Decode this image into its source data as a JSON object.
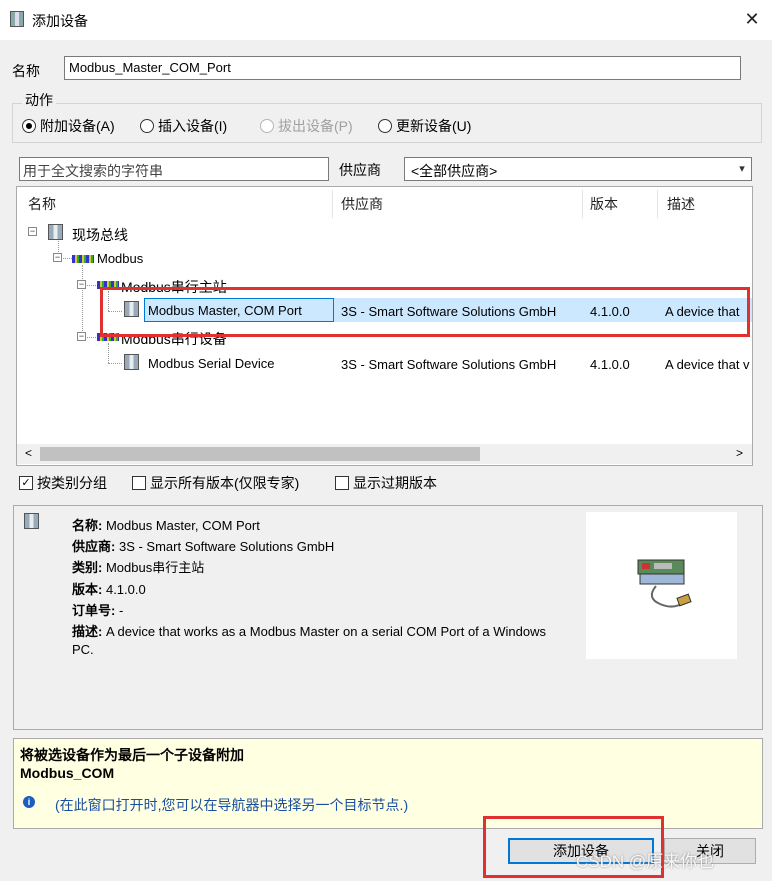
{
  "dialog": {
    "title": "添加设备"
  },
  "name": {
    "label": "名称",
    "value": "Modbus_Master_COM_Port"
  },
  "action": {
    "group_label": "动作",
    "options": [
      {
        "label": "附加设备(A)",
        "selected": true,
        "enabled": true
      },
      {
        "label": "插入设备(I)",
        "selected": false,
        "enabled": true
      },
      {
        "label": "拔出设备(P)",
        "selected": false,
        "enabled": false
      },
      {
        "label": "更新设备(U)",
        "selected": false,
        "enabled": true
      }
    ]
  },
  "search": {
    "placeholder": "用于全文搜索的字符串"
  },
  "vendor": {
    "label": "供应商",
    "selected": "<全部供应商>"
  },
  "columns": [
    "名称",
    "供应商",
    "版本",
    "描述"
  ],
  "tree": {
    "root": "现场总线",
    "bus": "Modbus",
    "group_master": "Modbus串行主站",
    "group_device": "Modbus串行设备",
    "rows": [
      {
        "name": "Modbus Master, COM Port",
        "vendor": "3S - Smart Software Solutions GmbH",
        "version": "4.1.0.0",
        "desc": "A device that"
      },
      {
        "name": "Modbus Serial Device",
        "vendor": "3S - Smart Software Solutions GmbH",
        "version": "4.1.0.0",
        "desc": "A device that v"
      }
    ]
  },
  "scroll": {
    "left": "<",
    "right": ">"
  },
  "options": [
    {
      "label": "按类别分组",
      "checked": true
    },
    {
      "label": "显示所有版本(仅限专家)",
      "checked": false
    },
    {
      "label": "显示过期版本",
      "checked": false
    }
  ],
  "details": {
    "name_key": "名称:",
    "name_val": "Modbus Master, COM Port",
    "vendor_key": "供应商:",
    "vendor_val": "3S - Smart Software Solutions GmbH",
    "category_key": "类别:",
    "category_val": "Modbus串行主站",
    "version_key": "版本:",
    "version_val": "4.1.0.0",
    "order_key": "订单号:",
    "order_val": "-",
    "desc_key": "描述:",
    "desc_val_1": "A device that works as a Modbus Master on a serial COM Port of a Windows",
    "desc_val_2": "PC."
  },
  "note": {
    "line1": "将被选设备作为最后一个子设备附加",
    "line2": "Modbus_COM",
    "line3": "(在此窗口打开时,您可以在导航器中选择另一个目标节点.)"
  },
  "buttons": {
    "add": "添加设备",
    "close": "关闭"
  },
  "watermark": "CSDN @原来你也",
  "colors": {
    "selection": "#cce8ff",
    "highlight_box": "#e03030",
    "focus": "#0078d7"
  }
}
